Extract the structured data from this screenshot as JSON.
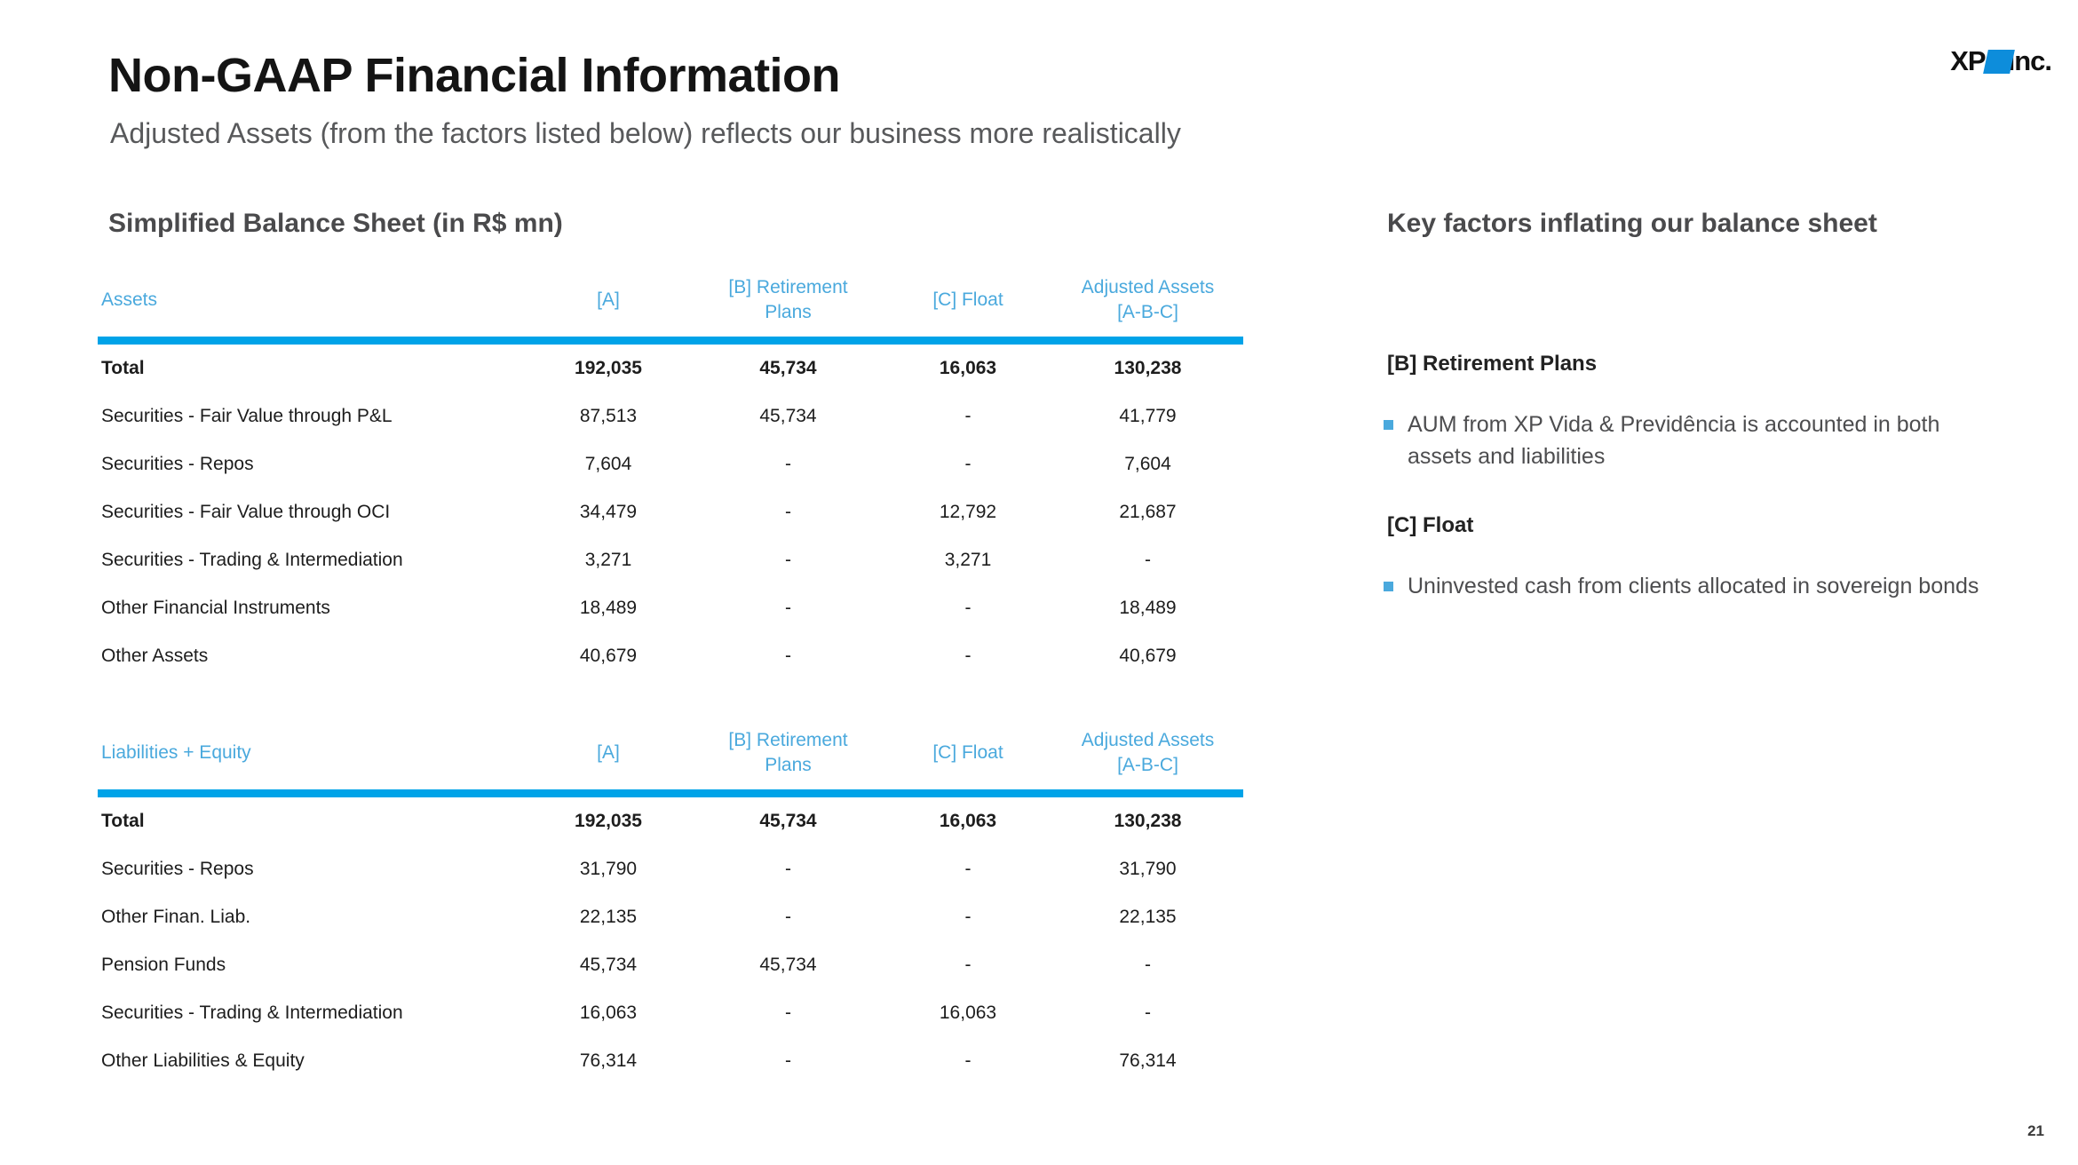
{
  "header": {
    "title": "Non-GAAP Financial Information",
    "subtitle": "Adjusted Assets (from the factors listed below) reflects our business more realistically",
    "logo": {
      "brand": "XP",
      "suffix": "Inc.",
      "mark_color": "#0d8ddb"
    }
  },
  "sections": {
    "balance_sheet_heading": "Simplified Balance Sheet (in R$ mn)",
    "key_factors_heading": "Key factors inflating our balance sheet"
  },
  "accent_colors": {
    "rule": "#00a3e8",
    "table_header_text": "#4aa9dd",
    "bullet": "#4aa9dd"
  },
  "chart_data": {
    "type": "table",
    "title": "Simplified Balance Sheet (in R$ mn)",
    "tables": [
      {
        "name": "assets",
        "columns": [
          "Assets",
          "[A]",
          "[B] Retirement Plans",
          "[C] Float",
          "Adjusted Assets [A-B-C]"
        ],
        "rows": [
          {
            "label": "Total",
            "a": "192,035",
            "b": "45,734",
            "c": "16,063",
            "adj": "130,238",
            "total": true
          },
          {
            "label": "Securities - Fair Value through P&L",
            "a": "87,513",
            "b": "45,734",
            "c": "-",
            "adj": "41,779",
            "total": false
          },
          {
            "label": "Securities - Repos",
            "a": "7,604",
            "b": "-",
            "c": "-",
            "adj": "7,604",
            "total": false
          },
          {
            "label": "Securities - Fair Value through OCI",
            "a": "34,479",
            "b": "-",
            "c": "12,792",
            "adj": "21,687",
            "total": false
          },
          {
            "label": "Securities - Trading & Intermediation",
            "a": "3,271",
            "b": "-",
            "c": "3,271",
            "adj": "-",
            "total": false
          },
          {
            "label": "Other Financial Instruments",
            "a": "18,489",
            "b": "-",
            "c": "-",
            "adj": "18,489",
            "total": false
          },
          {
            "label": "Other Assets",
            "a": "40,679",
            "b": "-",
            "c": "-",
            "adj": "40,679",
            "total": false
          }
        ]
      },
      {
        "name": "liabilities_equity",
        "columns": [
          "Liabilities + Equity",
          "[A]",
          "[B] Retirement Plans",
          "[C] Float",
          "Adjusted Assets [A-B-C]"
        ],
        "rows": [
          {
            "label": "Total",
            "a": "192,035",
            "b": "45,734",
            "c": "16,063",
            "adj": "130,238",
            "total": true
          },
          {
            "label": "Securities - Repos",
            "a": "31,790",
            "b": "-",
            "c": "-",
            "adj": "31,790",
            "total": false
          },
          {
            "label": "Other Finan. Liab.",
            "a": "22,135",
            "b": "-",
            "c": "-",
            "adj": "22,135",
            "total": false
          },
          {
            "label": "Pension Funds",
            "a": "45,734",
            "b": "45,734",
            "c": "-",
            "adj": "-",
            "total": false
          },
          {
            "label": "Securities - Trading & Intermediation",
            "a": "16,063",
            "b": "-",
            "c": "16,063",
            "adj": "-",
            "total": false
          },
          {
            "label": "Other Liabilities & Equity",
            "a": "76,314",
            "b": "-",
            "c": "-",
            "adj": "76,314",
            "total": false
          }
        ]
      }
    ]
  },
  "table_headers": {
    "assets_label": "Assets",
    "liabilities_label": "Liabilities + Equity",
    "col_a": "[A]",
    "col_b_line1": "[B] Retirement",
    "col_b_line2": "Plans",
    "col_c": "[C] Float",
    "col_adj_line1": "Adjusted Assets",
    "col_adj_line2": "[A-B-C]"
  },
  "key_factors": [
    {
      "title": "[B] Retirement Plans",
      "bullet": "AUM from XP Vida & Previdência is accounted in both assets and liabilities",
      "justified": false
    },
    {
      "title": "[C] Float",
      "bullet": "Uninvested cash from clients allocated in sovereign bonds",
      "justified": true
    }
  ],
  "footer": {
    "page_number": "21"
  }
}
